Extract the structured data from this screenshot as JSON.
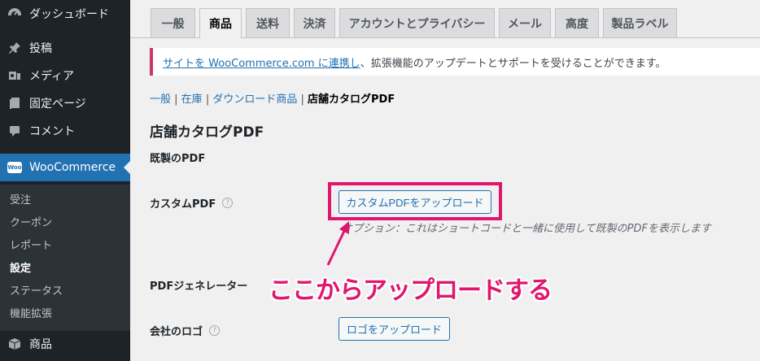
{
  "sidebar": {
    "items": [
      {
        "label": "ダッシュボード",
        "icon": "dashboard-icon"
      },
      {
        "label": "投稿",
        "icon": "pin-icon"
      },
      {
        "label": "メディア",
        "icon": "media-icon"
      },
      {
        "label": "固定ページ",
        "icon": "page-icon"
      },
      {
        "label": "コメント",
        "icon": "comment-icon"
      },
      {
        "label": "WooCommerce",
        "icon": "woocommerce-icon",
        "badge": "Woo"
      },
      {
        "label": "商品",
        "icon": "product-icon"
      }
    ],
    "submenu": [
      "受注",
      "クーポン",
      "レポート",
      "設定",
      "ステータス",
      "機能拡張"
    ],
    "current_submenu": "設定"
  },
  "tabs": [
    "一般",
    "商品",
    "送料",
    "決済",
    "アカウントとプライバシー",
    "メール",
    "高度",
    "製品ラベル"
  ],
  "active_tab": "商品",
  "notice": {
    "link": "サイトを WooCommerce.com に連携し",
    "text": "、拡張機能のアップデートとサポートを受けることができます。"
  },
  "subsub": {
    "links": [
      "一般",
      "在庫",
      "ダウンロード商品"
    ],
    "separator": " | ",
    "current": "店舗カタログPDF"
  },
  "section_title": "店舗カタログPDF",
  "fields": {
    "default_pdf": "既製のPDF",
    "custom_pdf": "カスタムPDF",
    "custom_pdf_button": "カスタムPDFをアップロード",
    "custom_pdf_desc": "オプション：これはショートコードと一緒に使用して既製のPDFを表示します",
    "pdf_generator": "PDFジェネレーター",
    "company_logo": "会社のロゴ",
    "logo_button": "ロゴをアップロード",
    "help_glyph": "?"
  },
  "annotation": {
    "callout": "ここからアップロードする",
    "color": "#e1156d"
  },
  "colors": {
    "sidebar_bg": "#1d2327",
    "accent": "#2271b1",
    "notice_border": "#c9356e"
  }
}
